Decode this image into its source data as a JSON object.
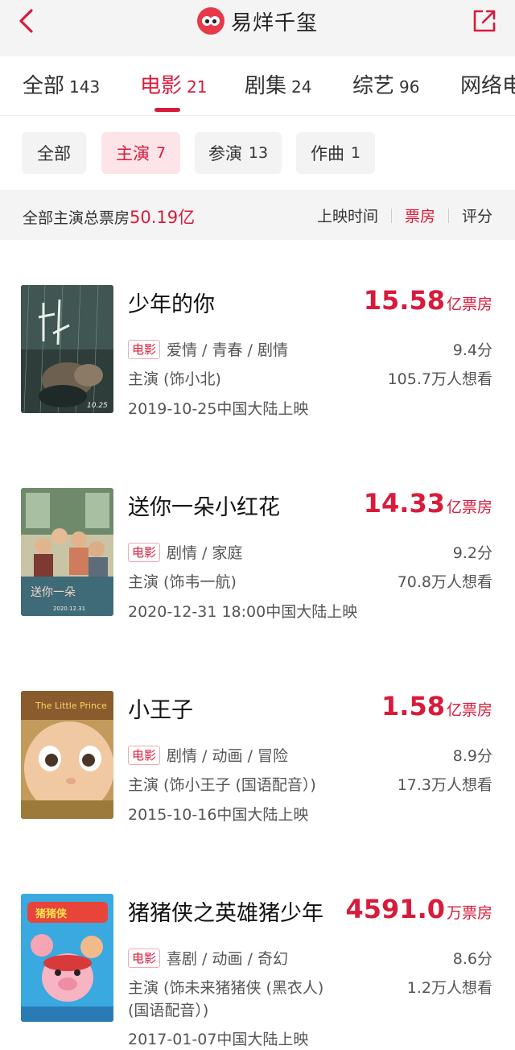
{
  "header": {
    "title": "易烊千玺",
    "back_icon": "chevron-left-icon",
    "share_icon": "share-icon",
    "accent": "#d81b3b"
  },
  "tabs": [
    {
      "label": "全部",
      "count": "143",
      "active": false
    },
    {
      "label": "电影",
      "count": "21",
      "active": true
    },
    {
      "label": "剧集",
      "count": "24",
      "active": false
    },
    {
      "label": "综艺",
      "count": "96",
      "active": false
    },
    {
      "label": "网络电",
      "count": "",
      "active": false
    }
  ],
  "chips": [
    {
      "label": "全部",
      "count": "",
      "active": false
    },
    {
      "label": "主演",
      "count": "7",
      "active": true
    },
    {
      "label": "参演",
      "count": "13",
      "active": false
    },
    {
      "label": "作曲",
      "count": "1",
      "active": false
    }
  ],
  "summary": {
    "text": "全部主演总票房",
    "total": "50.19亿",
    "sort": [
      {
        "label": "上映时间",
        "active": false
      },
      {
        "label": "票房",
        "active": true
      },
      {
        "label": "评分",
        "active": false
      }
    ]
  },
  "movies": [
    {
      "title": "少年的你",
      "box_office": "15.58",
      "box_unit": "亿票房",
      "tag": "电影",
      "genres": "爱情 / 青春 / 剧情",
      "score": "9.4分",
      "role": "主演 (饰小北)",
      "role_extra": "",
      "wish": "105.7万人想看",
      "release": "2019-10-25中国大陆上映",
      "poster_date": "10.25"
    },
    {
      "title": "送你一朵小红花",
      "box_office": "14.33",
      "box_unit": "亿票房",
      "tag": "电影",
      "genres": "剧情 / 家庭",
      "score": "9.2分",
      "role": "主演 (饰韦一航)",
      "role_extra": "",
      "wish": "70.8万人想看",
      "release": "2020-12-31 18:00中国大陆上映",
      "poster_date": "2020.12.31"
    },
    {
      "title": "小王子",
      "box_office": "1.58",
      "box_unit": "亿票房",
      "tag": "电影",
      "genres": "剧情 / 动画 / 冒险",
      "score": "8.9分",
      "role": "主演 (饰小王子 (国语配音）)",
      "role_extra": "",
      "wish": "17.3万人想看",
      "release": "2015-10-16中国大陆上映",
      "poster_date": ""
    },
    {
      "title": "猪猪侠之英雄猪少年",
      "box_office": "4591.0",
      "box_unit": "万票房",
      "tag": "电影",
      "genres": "喜剧 / 动画 / 奇幻",
      "score": "8.6分",
      "role": "主演 (饰未来猪猪侠 (黑衣人)",
      "role_extra": "(国语配音）)",
      "wish": "1.2万人想看",
      "release": "2017-01-07中国大陆上映",
      "poster_date": ""
    }
  ]
}
